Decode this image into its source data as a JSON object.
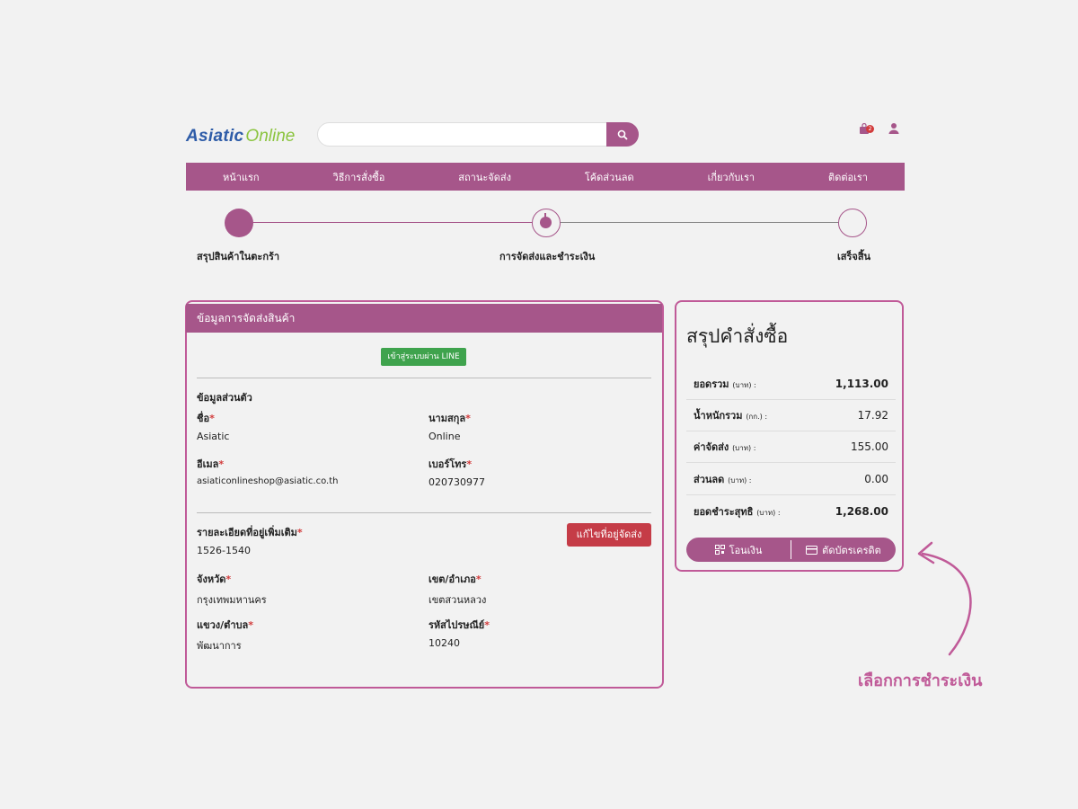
{
  "header": {
    "logo_part1": "Asiatic",
    "logo_part2": "Online",
    "search_placeholder": "",
    "cart_count": "2"
  },
  "nav": [
    "หน้าแรก",
    "วิธีการสั่งซื้อ",
    "สถานะจัดส่ง",
    "โค้ดส่วนลด",
    "เกี่ยวกับเรา",
    "ติดต่อเรา"
  ],
  "steps": [
    "สรุปสินค้าในตะกร้า",
    "การจัดส่งและชำระเงิน",
    "เสร็จสิ้น"
  ],
  "shipping": {
    "title": "ข้อมูลการจัดส่งสินค้า",
    "line_login": "เข้าสู่ระบบผ่าน LINE",
    "personal_heading": "ข้อมูลส่วนตัว",
    "first_name_label": "ชื่อ",
    "first_name": "Asiatic",
    "last_name_label": "นามสกุล",
    "last_name": "Online",
    "email_label": "อีเมล",
    "email": "asiaticonlineshop@asiatic.co.th",
    "phone_label": "เบอร์โทร",
    "phone": "020730977",
    "address_label": "รายละเอียดที่อยู่เพิ่มเติม",
    "address": "1526-1540",
    "edit_button": "แก้ไขที่อยู่จัดส่ง",
    "province_label": "จังหวัด",
    "province": "กรุงเทพมหานคร",
    "district_label": "เขต/อำเภอ",
    "district": "เขตสวนหลวง",
    "subdistrict_label": "แขวง/ตำบล",
    "subdistrict": "พัฒนาการ",
    "postcode_label": "รหัสไปรษณีย์",
    "postcode": "10240"
  },
  "summary": {
    "title": "สรุปคำสั่งซื้อ",
    "rows": [
      {
        "label": "ยอดรวม",
        "unit": "(บาท) :",
        "value": "1,113.00"
      },
      {
        "label": "น้ำหนักรวม",
        "unit": "(กก.) :",
        "value": "17.92"
      },
      {
        "label": "ค่าจัดส่ง",
        "unit": "(บาท) :",
        "value": "155.00"
      },
      {
        "label": "ส่วนลด",
        "unit": "(บาท) :",
        "value": "0.00"
      },
      {
        "label": "ยอดชำระสุทธิ",
        "unit": "(บาท) :",
        "value": "1,268.00"
      }
    ],
    "pay_transfer": "โอนเงิน",
    "pay_card": "ตัดบัตรเครดิต"
  },
  "annotation": "เลือกการชำระเงิน",
  "colors": {
    "brand": "#a6568a",
    "annotation": "#c05a98",
    "line_green": "#3fa34d",
    "edit_red": "#c53c47"
  }
}
